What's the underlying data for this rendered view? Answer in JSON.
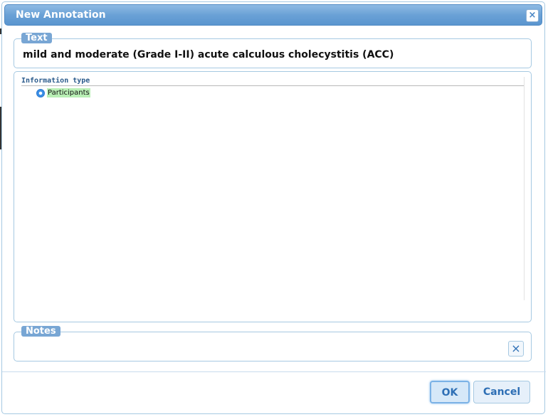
{
  "dialog": {
    "title": "New Annotation",
    "close_symbol": "×"
  },
  "text_section": {
    "legend": "Text",
    "value": "mild and moderate (Grade I-II) acute calculous cholecystitis (ACC)"
  },
  "types_section": {
    "header": "Information type",
    "items": [
      {
        "label": "Participants",
        "selected": true,
        "highlight_color": "#b9efb5"
      }
    ]
  },
  "notes_section": {
    "legend": "Notes",
    "value": "",
    "clear_symbol": "×"
  },
  "buttons": {
    "ok": "OK",
    "cancel": "Cancel"
  },
  "colors": {
    "titlebar": "#6aa1d6",
    "border": "#a6c9e2",
    "legend_bg": "#78a6d4",
    "button_text": "#2e6fb5"
  }
}
